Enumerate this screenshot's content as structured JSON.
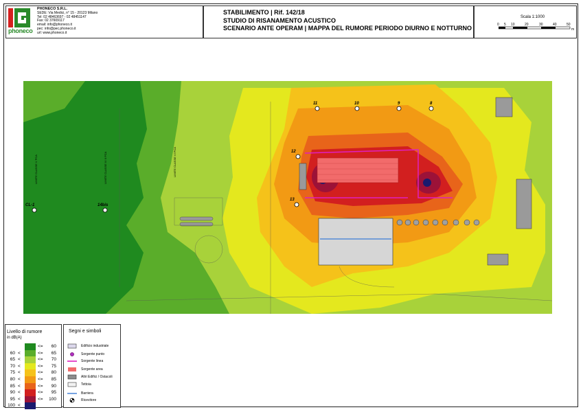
{
  "company": {
    "logo_text": "phoneco",
    "name": "PHONECO S.R.L.",
    "lines": [
      "SEDE: Via Medici, n° 15 - 20123 Milano",
      "Tel: 02 48463697 - 02 48451147",
      "Fax: 02 37609117",
      "email: info@phoneco.it",
      "pec: info@pec.phoneco.it",
      "url: www.phoneco.it"
    ]
  },
  "title_block": {
    "line1": "STABILIMENTO | Rif. 142/18",
    "line2": "STUDIO DI RISANAMENTO ACUSTICO",
    "line3": "SCENARIO ANTE OPERAM | MAPPA DEL RUMORE PERIODO DIURNO E NOTTURNO"
  },
  "scale": {
    "label": "Scala 1:1000",
    "ticks": [
      "0",
      "5",
      "10",
      "20",
      "30",
      "40",
      "50"
    ],
    "unit": "m"
  },
  "noise_legend": {
    "title": "Livello di rumore",
    "unit": "in dB(A)",
    "classes": [
      {
        "low": "",
        "lt": "",
        "le": "<=",
        "high": "60",
        "color": "#1f8a1f"
      },
      {
        "low": "60",
        "lt": "<",
        "le": "<=",
        "high": "65",
        "color": "#5aad2a"
      },
      {
        "low": "65",
        "lt": "<",
        "le": "<=",
        "high": "70",
        "color": "#a8d23a"
      },
      {
        "low": "70",
        "lt": "<",
        "le": "<=",
        "high": "75",
        "color": "#e4e81e"
      },
      {
        "low": "75",
        "lt": "<",
        "le": "<=",
        "high": "80",
        "color": "#f5c21a"
      },
      {
        "low": "80",
        "lt": "<",
        "le": "<=",
        "high": "85",
        "color": "#f29a14"
      },
      {
        "low": "85",
        "lt": "<",
        "le": "<=",
        "high": "90",
        "color": "#e8641a"
      },
      {
        "low": "90",
        "lt": "<",
        "le": "<=",
        "high": "95",
        "color": "#d21f1f"
      },
      {
        "low": "95",
        "lt": "<",
        "le": "<=",
        "high": "100",
        "color": "#9c1238"
      },
      {
        "low": "100",
        "lt": "<",
        "le": "",
        "high": "",
        "color": "#1a1a6e"
      }
    ]
  },
  "symbols_legend": {
    "title": "Segni e simboli",
    "items": [
      {
        "label": "Edificio industriale",
        "icon": "industrial-building-icon"
      },
      {
        "label": "Sorgente punto",
        "icon": "point-source-icon"
      },
      {
        "label": "Sorgente linea",
        "icon": "line-source-icon"
      },
      {
        "label": "Sorgente area",
        "icon": "area-source-icon"
      },
      {
        "label": "Altri Edifici / Ostacoli",
        "icon": "other-buildings-icon"
      },
      {
        "label": "Tettoia",
        "icon": "canopy-icon"
      },
      {
        "label": "Barriera",
        "icon": "barrier-icon"
      },
      {
        "label": "Ricevitore",
        "icon": "receiver-icon"
      }
    ]
  },
  "map": {
    "receivers": [
      "CL-1",
      "14bis",
      "11",
      "10",
      "9",
      "8",
      "12",
      "13"
    ],
    "boundary_labels": [
      "LIMITE CLASSE V PCA",
      "LIMITE CLASSE IV II PCA",
      "LIMITE CLASSE VI PCA"
    ],
    "colors": {
      "bg": "#1f8a1f",
      "c65": "#5aad2a",
      "c70": "#a8d23a",
      "c75": "#e4e81e",
      "c80": "#f5c21a",
      "c85": "#f29a14",
      "c90": "#e8641a",
      "c95": "#d21f1f",
      "c100": "#9c1238",
      "c100p": "#1a1a6e",
      "source_area": "#f26b6b",
      "source_line": "#e020c0",
      "barrier": "#3a7bd5",
      "building": "#b0b0b0"
    }
  }
}
